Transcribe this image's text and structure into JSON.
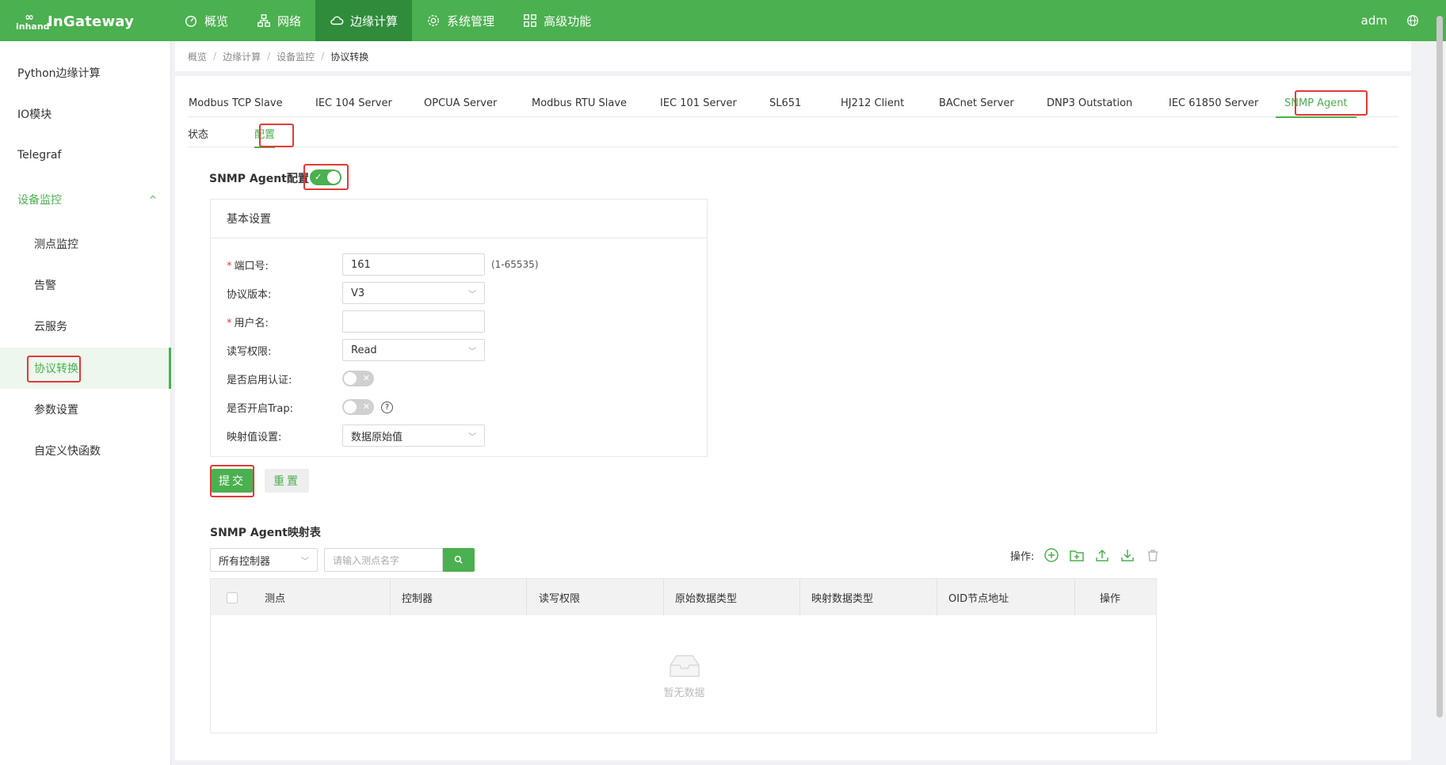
{
  "brand": {
    "logo_mark": "inhand",
    "name": "InGateway"
  },
  "nav": [
    {
      "label": "概览",
      "icon": "dashboard-icon"
    },
    {
      "label": "网络",
      "icon": "network-icon"
    },
    {
      "label": "边缘计算",
      "icon": "cloud-icon"
    },
    {
      "label": "系统管理",
      "icon": "gear-icon"
    },
    {
      "label": "高级功能",
      "icon": "grid-icon"
    }
  ],
  "user": {
    "name": "adm"
  },
  "sidebar": {
    "items": [
      {
        "label": "Python边缘计算"
      },
      {
        "label": "IO模块"
      },
      {
        "label": "Telegraf"
      },
      {
        "label": "设备监控",
        "chevron": "^"
      },
      {
        "label": "测点监控"
      },
      {
        "label": "告警"
      },
      {
        "label": "云服务"
      },
      {
        "label": "协议转换"
      },
      {
        "label": "参数设置"
      },
      {
        "label": "自定义快函数"
      }
    ]
  },
  "breadcrumb": [
    "概览",
    "边缘计算",
    "设备监控",
    "协议转换"
  ],
  "breadcrumb_sep": "/",
  "tabs": [
    "Modbus TCP Slave",
    "IEC 104 Server",
    "OPCUA Server",
    "Modbus RTU Slave",
    "IEC 101 Server",
    "SL651",
    "HJ212 Client",
    "BACnet Server",
    "DNP3 Outstation",
    "IEC 61850 Server",
    "SNMP Agent"
  ],
  "subtabs": [
    "状态",
    "配置"
  ],
  "config": {
    "title": "SNMP Agent配置",
    "enabled": true,
    "panel_title": "基本设置",
    "switch_on_mark": "✓",
    "switch_off_mark": "✕",
    "fields": {
      "port": {
        "label": "端口号:",
        "value": "161",
        "hint": "(1-65535)",
        "required": "*"
      },
      "version": {
        "label": "协议版本:",
        "value": "V3"
      },
      "username": {
        "label": "用户名:",
        "value": "",
        "required": "*"
      },
      "rw": {
        "label": "读写权限:",
        "value": "Read"
      },
      "auth": {
        "label": "是否启用认证:",
        "enabled": false
      },
      "trap": {
        "label": "是否开启Trap:",
        "enabled": false,
        "help": "?"
      },
      "mapping": {
        "label": "映射值设置:",
        "value": "数据原始值"
      }
    },
    "submit": "提交",
    "reset": "重置"
  },
  "mapping_table": {
    "title": "SNMP Agent映射表",
    "controller_filter": "所有控制器",
    "search_placeholder": "请输入测点名字",
    "ops_label": "操作:",
    "columns": [
      "测点",
      "控制器",
      "读写权限",
      "原始数据类型",
      "映射数据类型",
      "OID节点地址",
      "操作"
    ],
    "empty_text": "暂无数据"
  },
  "colors": {
    "primary": "#4bb04f",
    "nav_active": "#2f8c3b",
    "highlight": "#e53935"
  }
}
